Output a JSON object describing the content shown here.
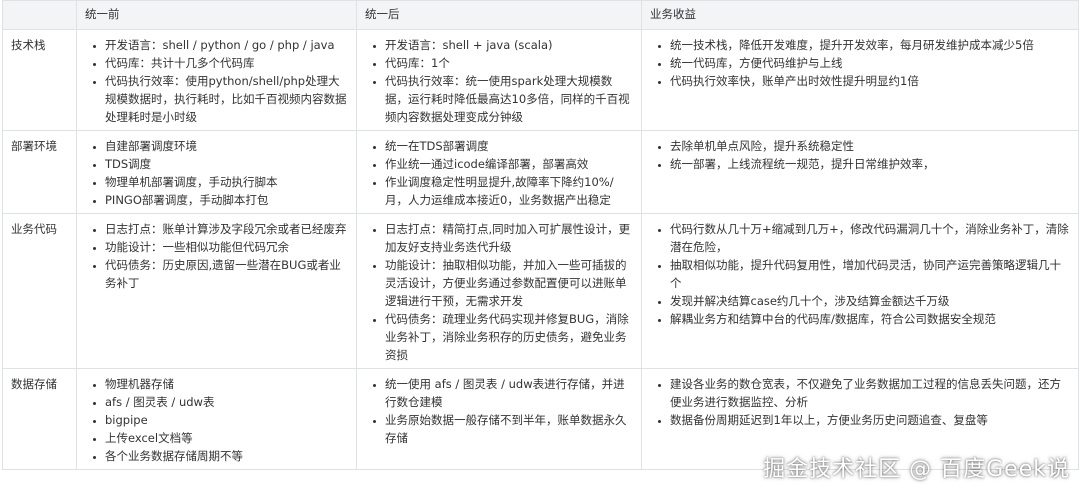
{
  "table": {
    "headers": [
      "",
      "统一前",
      "统一后",
      "业务收益"
    ],
    "rows": [
      {
        "label": "技术栈",
        "before": [
          "开发语言：shell / python / go / php / java",
          "代码库：共计十几多个代码库",
          "代码执行效率：使用python/shell/php处理大规模数据时，执行耗时，比如千百视频内容数据处理耗时是小时级"
        ],
        "after": [
          "开发语言：shell + java (scala)",
          "代码库：1个",
          "代码执行效率：统一使用spark处理大规模数据，运行耗时降低最高达10多倍，同样的千百视频内容数据处理变成分钟级"
        ],
        "benefit": [
          "统一技术栈，降低开发难度，提升开发效率，每月研发维护成本减少5倍",
          "统一代码库，方便代码维护与上线",
          "代码执行效率快，账单产出时效性提升明显约1倍"
        ]
      },
      {
        "label": "部署环境",
        "before": [
          "自建部署调度环境",
          "TDS调度",
          "物理单机部署调度，手动执行脚本",
          "PINGO部署调度，手动脚本打包"
        ],
        "after": [
          "统一在TDS部署调度",
          "作业统一通过icode编译部署，部署高效",
          "作业调度稳定性明显提升,故障率下降约10%/月，人力运维成本接近0，业务数据产出稳定"
        ],
        "benefit": [
          "去除单机单点风险，提升系统稳定性",
          "统一部署，上线流程统一规范，提升日常维护效率，"
        ]
      },
      {
        "label": "业务代码",
        "before": [
          "日志打点：账单计算涉及字段冗余或者已经废弃",
          "功能设计：一些相似功能但代码冗余",
          "代码债务：历史原因,遗留一些潜在BUG或者业务补丁"
        ],
        "after": [
          "日志打点：精简打点,同时加入可扩展性设计，更加友好支持业务迭代升级",
          "功能设计：抽取相似功能，并加入一些可插拔的灵活设计，方便业务通过参数配置便可以进账单逻辑进行干预，无需求开发",
          "代码债务：疏理业务代码实现并修复BUG，消除业务补丁，消除业务积存的历史债务，避免业务资损"
        ],
        "benefit": [
          "代码行数从几十万+缩减到几万+，修改代码漏洞几十个，消除业务补丁，清除潜在危险，",
          "抽取相似功能，提升代码复用性，增加代码灵活，协同产运完善策略逻辑几十个",
          "发现并解决结算case约几十个，涉及结算金额达千万级",
          "解耦业务方和结算中台的代码库/数据库，符合公司数据安全规范"
        ]
      },
      {
        "label": "数据存储",
        "before": [
          "物理机器存储",
          "afs / 图灵表 / udw表",
          "bigpipe",
          "上传excel文档等",
          "各个业务数据存储周期不等"
        ],
        "after": [
          "统一使用 afs / 图灵表 / udw表进行存储，并进行数仓建模",
          "业务原始数据一般存储不到半年，账单数据永久存储"
        ],
        "benefit": [
          "建设各业务的数仓宽表，不仅避免了业务数据加工过程的信息丢失问题，还方便业务进行数据监控、分析",
          "数据备份周期延迟到1年以上，方便业务历史问题追查、复盘等"
        ]
      }
    ]
  },
  "watermark": "掘金技术社区 @ 百度Geek说"
}
